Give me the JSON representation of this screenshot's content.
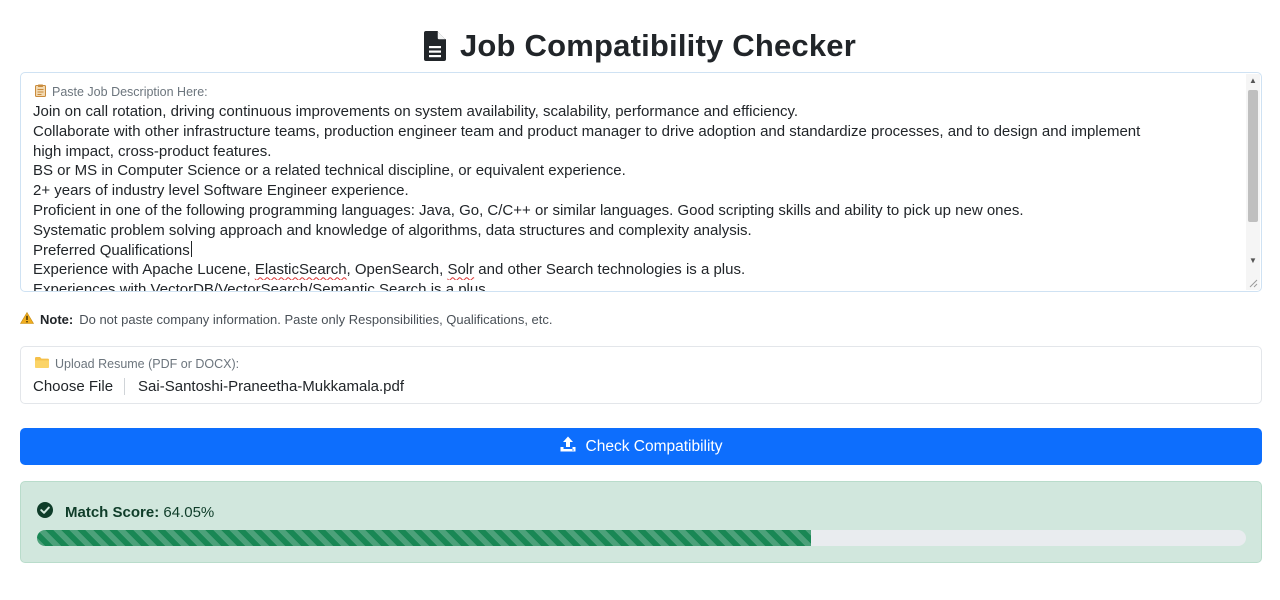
{
  "header": {
    "title": "Job Compatibility Checker",
    "icon": "document-icon"
  },
  "job_description": {
    "label": "Paste Job Description Here:",
    "label_icon": "clipboard-icon",
    "lines": [
      "Join on call rotation, driving continuous improvements on system availability, scalability, performance and efficiency.",
      "Collaborate with other infrastructure teams, production engineer team and product manager to drive adoption and standardize processes, and to design and implement",
      "high impact, cross-product features.",
      "BS or MS in Computer Science or a related technical discipline, or equivalent experience.",
      "2+ years of industry level Software Engineer experience.",
      "Proficient in one of the following programming languages: Java, Go, C/C++ or similar languages. Good scripting skills and ability to pick up new ones.",
      "Systematic problem solving approach and knowledge of algorithms, data structures and complexity analysis.",
      "Preferred Qualifications",
      "Experience with Apache Lucene, ElasticSearch, OpenSearch, Solr and other Search technologies is a plus.",
      "Experiences with VectorDB/VectorSearch/Semantic Search is a plus."
    ],
    "misspelled": [
      "ElasticSearch",
      "Solr"
    ]
  },
  "note": {
    "icon": "warning-icon",
    "bold": "Note:",
    "text": "Do not paste company information. Paste only Responsibilities, Qualifications, etc."
  },
  "upload": {
    "label": "Upload Resume (PDF or DOCX):",
    "label_icon": "folder-icon",
    "button_label": "Choose File",
    "file_name": "Sai-Santoshi-Praneetha-Mukkamala.pdf"
  },
  "action": {
    "label": "Check Compatibility",
    "icon": "upload-icon",
    "color": "#0d6efd"
  },
  "result": {
    "icon": "check-circle-icon",
    "label": "Match Score:",
    "value": "64.05%",
    "progress_percent": 64.05,
    "bar_color": "#198754",
    "background": "#d1e7dd"
  }
}
